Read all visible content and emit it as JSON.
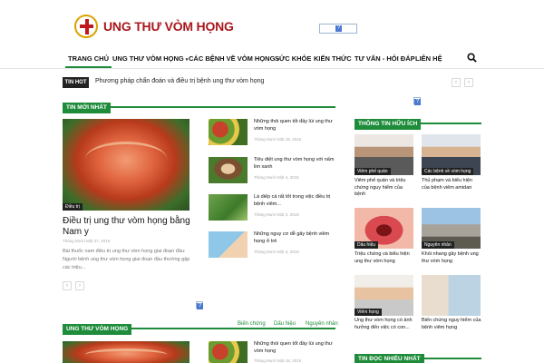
{
  "header": {
    "logo_text": "UNG THƯ VÒM HỌNG",
    "ad_icon": "?"
  },
  "nav": {
    "items": [
      {
        "label": "TRANG CHỦ",
        "caret": ""
      },
      {
        "label": "UNG THƯ VÒM HỌNG",
        "caret": "▾"
      },
      {
        "label": "CÁC BỆNH VỀ VÒM HỌNG",
        "caret": "▾"
      },
      {
        "label": "SỨC KHỎE",
        "caret": ""
      },
      {
        "label": "KIẾN THỨC",
        "caret": ""
      },
      {
        "label": "TƯ VẤN - HỎI ĐÁP",
        "caret": ""
      },
      {
        "label": "LIÊN HỆ",
        "caret": ""
      }
    ]
  },
  "hot": {
    "label": "TIN HOT",
    "text": "Phương pháp chẩn đoán và điều trị bệnh ung thư vòm họng",
    "prev": "‹",
    "next": "›"
  },
  "latest": {
    "title": "TIN MỚI NHẤT",
    "main": {
      "category": "Điều trị",
      "title": "Điều trị ung thư vòm họng bằng Nam y",
      "meta": "Tháng Mười Một 27, 2015",
      "excerpt": "Bài thuốc nam điều trị ung thư vòm họng giai đoạn đầu: Người bệnh ung thư vòm họng giai đoạn đầu thường gặp các triệu..."
    },
    "list": [
      {
        "title": "Những thói quen tốt đầy lùi ung thư vòm họng",
        "meta": "Tháng Mười Một 18, 2015"
      },
      {
        "title": "Tiêu diệt ung thư vòm họng với nấm lim xanh",
        "meta": "Tháng Mười Một 4, 2015"
      },
      {
        "title": "Lá diếp cá rất tốt trong việc điều trị bệnh viêm...",
        "meta": "Tháng Mười Một 3, 2015"
      },
      {
        "title": "Những nguy cơ dễ gây bệnh viêm họng ở trẻ",
        "meta": "Tháng Mười Một 3, 2015"
      }
    ],
    "pager": {
      "prev": "‹",
      "next": "›"
    }
  },
  "useful": {
    "title": "THÔNG TIN HỮU ÍCH",
    "items": [
      {
        "category": "Viêm phế quản",
        "title": "Viêm phế quản và triệu chứng nguy hiểm của bệnh"
      },
      {
        "category": "Các bệnh về vòm họng",
        "title": "Thủ phạm và biểu hiện của bệnh viêm amidan"
      },
      {
        "category": "Dấu hiệu",
        "title": "Triệu chứng và biểu hiện ung thư vòm họng"
      },
      {
        "category": "Nguyên nhân",
        "title": "Khói nhang gây bệnh ung thư vòm họng"
      },
      {
        "category": "Viêm họng",
        "title": "Ung thư vòm họng có ảnh hưởng đến việc có con..."
      },
      {
        "category": "",
        "title": "Biến chứng nguy hiểm của bệnh viêm họng"
      }
    ]
  },
  "section2": {
    "title": "UNG THƯ VÒM HỌNG",
    "tabs": [
      "Biến chứng",
      "Dấu hiệu",
      "Nguyên nhân"
    ],
    "list_first": {
      "title": "Những thói quen tốt đầy lùi ung thư vòm họng",
      "meta": "Tháng Mười Một 18, 2015"
    }
  },
  "most_read": {
    "title": "TIN ĐỌC NHIỀU NHẤT"
  }
}
